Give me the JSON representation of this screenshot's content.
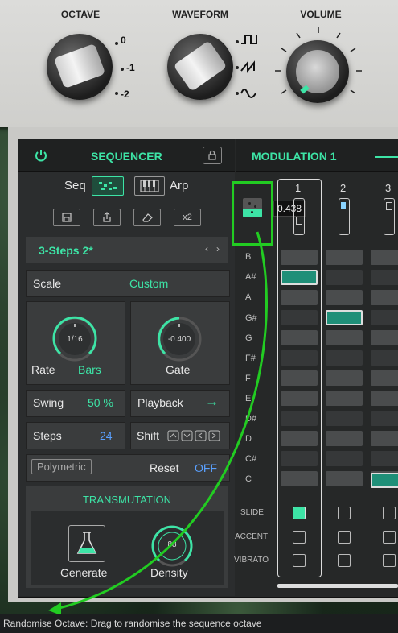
{
  "top_panel": {
    "octave": {
      "title": "OCTAVE",
      "labels": [
        "0",
        "-1",
        "-2"
      ]
    },
    "waveform": {
      "title": "WAVEFORM"
    },
    "volume": {
      "title": "VOLUME"
    }
  },
  "sequencer": {
    "title": "SEQUENCER",
    "seq_label": "Seq",
    "arp_label": "Arp",
    "x2_label": "x2",
    "preset_name": "3-Steps 2*",
    "scale_label": "Scale",
    "scale_value": "Custom",
    "rate_label": "Rate",
    "rate_value": "Bars",
    "rate_knob_value": "1/16",
    "gate_label": "Gate",
    "gate_knob_value": "-0.400",
    "swing_label": "Swing",
    "swing_value": "50 %",
    "playback_label": "Playback",
    "playback_arrow": "→",
    "steps_label": "Steps",
    "steps_value": "24",
    "shift_label": "Shift",
    "polymetric_label": "Polymetric",
    "reset_label": "Reset",
    "reset_value": "OFF",
    "transmutation_title": "TRANSMUTATION",
    "generate_label": "Generate",
    "density_label": "Density",
    "density_value": "88"
  },
  "modulation": {
    "tab_label": "MODULATION 1",
    "randomise_value": "0.438",
    "step_numbers": [
      "1",
      "2",
      "3"
    ],
    "notes": [
      "B",
      "A#",
      "A",
      "G#",
      "G",
      "F#",
      "F",
      "E",
      "D#",
      "D",
      "C#",
      "C"
    ],
    "row_labels": [
      "SLIDE",
      "ACCENT",
      "VIBRATO"
    ]
  },
  "tooltip": {
    "text": "Randomise Octave: Drag to randomise the sequence octave"
  },
  "colors": {
    "accent": "#3de4a6",
    "highlight": "#22cc22",
    "blue_value": "#5aa0ff"
  }
}
